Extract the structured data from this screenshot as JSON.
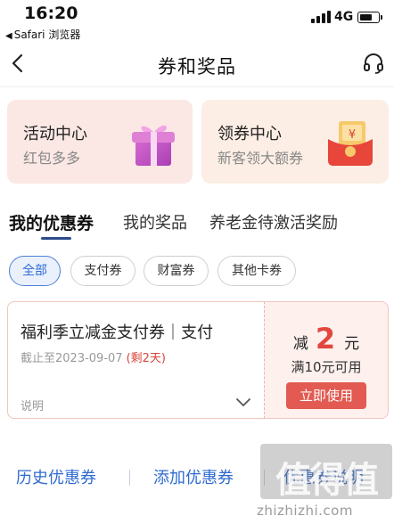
{
  "status_bar": {
    "time": "16:20",
    "back_app": "Safari 浏览器",
    "network": "4G"
  },
  "nav": {
    "title": "券和奖品",
    "back_icon": "chevron-left-icon",
    "support_icon": "headset-icon"
  },
  "promos": [
    {
      "title": "活动中心",
      "subtitle": "红包多多",
      "icon": "gift-box-icon"
    },
    {
      "title": "领券中心",
      "subtitle": "新客领大额券",
      "icon": "red-envelope-icon"
    }
  ],
  "tabs": [
    {
      "label": "我的优惠券",
      "active": true
    },
    {
      "label": "我的奖品",
      "active": false
    },
    {
      "label": "养老金待激活奖励",
      "active": false
    }
  ],
  "filters": [
    {
      "label": "全部",
      "active": true
    },
    {
      "label": "支付券",
      "active": false
    },
    {
      "label": "财富券",
      "active": false
    },
    {
      "label": "其他卡券",
      "active": false
    }
  ],
  "coupon": {
    "title": "福利季立减金支付券｜支付",
    "expiry": "截止至2023-09-07",
    "remaining": "(剩2天)",
    "note": "说明",
    "amount_prefix": "减",
    "amount": "2",
    "amount_unit": "元",
    "condition": "满10元可用",
    "use_button": "立即使用"
  },
  "bottom_links": {
    "history": "历史优惠券",
    "add": "添加优惠券",
    "rules": "优惠券说明"
  },
  "watermark": {
    "text": "值得值",
    "url": "zhizhizhi.com"
  },
  "colors": {
    "accent_blue": "#2f6bd0",
    "coupon_red": "#e2473f",
    "promo_bg": "#fbe8e4"
  }
}
